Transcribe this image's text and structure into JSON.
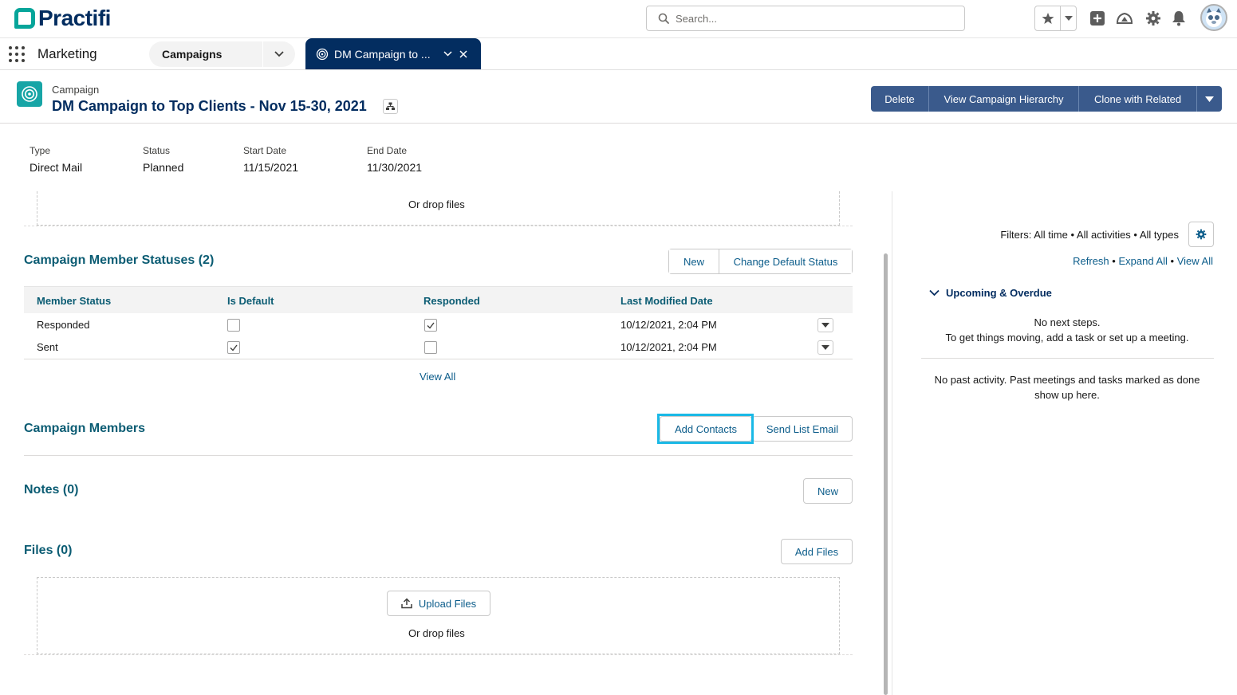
{
  "brand": {
    "name": "Practifi",
    "teal": "#06a59a",
    "navy": "#032d60"
  },
  "global_header": {
    "search_placeholder": "Search..."
  },
  "nav": {
    "app_name": "Marketing",
    "item_label": "Campaigns",
    "tab_label": "DM Campaign to ..."
  },
  "record": {
    "object_type": "Campaign",
    "title": "DM Campaign to Top Clients - Nov 15-30, 2021",
    "actions": [
      "Delete",
      "View Campaign Hierarchy",
      "Clone with Related"
    ]
  },
  "highlights": [
    {
      "label": "Type",
      "value": "Direct Mail"
    },
    {
      "label": "Status",
      "value": "Planned"
    },
    {
      "label": "Start Date",
      "value": "11/15/2021"
    },
    {
      "label": "End Date",
      "value": "11/30/2021"
    }
  ],
  "drop_files_top": "Or drop files",
  "member_statuses": {
    "title": "Campaign Member Statuses (2)",
    "new_label": "New",
    "change_default_label": "Change Default Status",
    "columns": [
      "Member Status",
      "Is Default",
      "Responded",
      "Last Modified Date"
    ],
    "rows": [
      {
        "status": "Responded",
        "is_default": false,
        "responded": true,
        "modified": "10/12/2021, 2:04 PM"
      },
      {
        "status": "Sent",
        "is_default": true,
        "responded": false,
        "modified": "10/12/2021, 2:04 PM"
      }
    ],
    "view_all": "View All"
  },
  "campaign_members": {
    "title": "Campaign Members",
    "add_contacts_label": "Add Contacts",
    "send_list_email_label": "Send List Email"
  },
  "notes": {
    "title": "Notes (0)",
    "new_label": "New"
  },
  "files": {
    "title": "Files (0)",
    "add_files_label": "Add Files",
    "upload_label": "Upload Files",
    "drop_text": "Or drop files"
  },
  "activity": {
    "filters": "Filters: All time • All activities • All types",
    "refresh": "Refresh",
    "expand_all": "Expand All",
    "view_all": "View All",
    "upcoming_title": "Upcoming & Overdue",
    "no_next_steps": "No next steps.",
    "next_steps_hint": "To get things moving, add a task or set up a meeting.",
    "past_activity": "No past activity. Past meetings and tasks marked as done show up here."
  }
}
